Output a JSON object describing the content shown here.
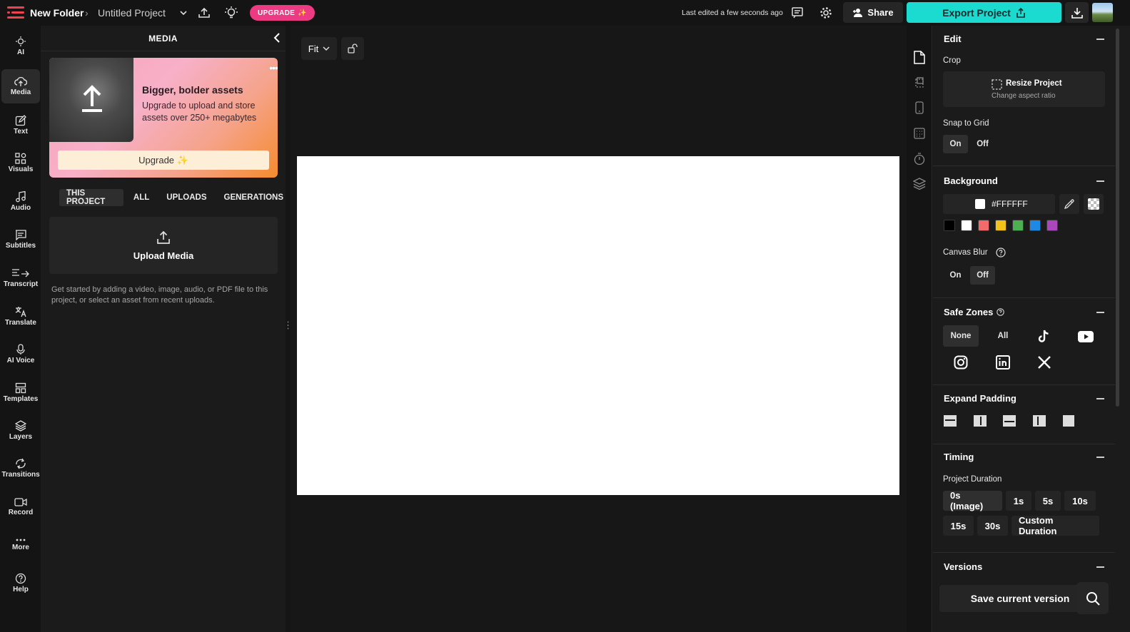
{
  "topbar": {
    "folder": "New Folder",
    "project": "Untitled Project",
    "upgrade_label": "UPGRADE",
    "last_edited": "Last edited a few seconds ago",
    "share_label": "Share",
    "export_label": "Export Project"
  },
  "leftnav": {
    "items": [
      {
        "label": "AI",
        "icon": "sparkle-icon"
      },
      {
        "label": "Media",
        "icon": "upload-cloud-icon"
      },
      {
        "label": "Text",
        "icon": "edit-icon"
      },
      {
        "label": "Visuals",
        "icon": "shapes-icon"
      },
      {
        "label": "Audio",
        "icon": "music-icon"
      },
      {
        "label": "Subtitles",
        "icon": "subtitles-icon"
      },
      {
        "label": "Transcript",
        "icon": "transcript-icon"
      },
      {
        "label": "Translate",
        "icon": "translate-icon"
      },
      {
        "label": "AI Voice",
        "icon": "voice-icon"
      },
      {
        "label": "Templates",
        "icon": "templates-icon"
      },
      {
        "label": "Layers",
        "icon": "layers-icon"
      },
      {
        "label": "Transitions",
        "icon": "transitions-icon"
      },
      {
        "label": "Record",
        "icon": "record-icon"
      },
      {
        "label": "More",
        "icon": "more-icon"
      },
      {
        "label": "Help",
        "icon": "help-icon"
      }
    ]
  },
  "media": {
    "title": "MEDIA",
    "promo": {
      "title": "Bigger, bolder assets",
      "text": "Upgrade to upload and store assets over 250+ megabytes",
      "button": "Upgrade ✨"
    },
    "tabs": [
      "THIS PROJECT",
      "ALL",
      "UPLOADS",
      "GENERATIONS"
    ],
    "upload_label": "Upload Media",
    "help_text": "Get started by adding a video, image, audio, or PDF file to this project, or select an asset from recent uploads."
  },
  "stage": {
    "fit_label": "Fit"
  },
  "props": {
    "edit_title": "Edit",
    "crop_label": "Crop",
    "resize_title": "Resize Project",
    "resize_sub": "Change aspect ratio",
    "snap_label": "Snap to Grid",
    "snap_on": "On",
    "snap_off": "Off",
    "background_title": "Background",
    "hex_value": "#FFFFFF",
    "swatches": [
      "#000000",
      "#ffffff",
      "#f26a6a",
      "#f2c21b",
      "#4caf50",
      "#1e88e5",
      "#ab47bc"
    ],
    "canvas_blur_label": "Canvas Blur",
    "blur_on": "On",
    "blur_off": "Off",
    "safe_zones_title": "Safe Zones",
    "sz_none": "None",
    "sz_all": "All",
    "expand_padding_title": "Expand Padding",
    "timing_title": "Timing",
    "duration_label": "Project Duration",
    "durations": [
      "0s (Image)",
      "1s",
      "5s",
      "10s",
      "15s",
      "30s",
      "Custom Duration"
    ],
    "versions_title": "Versions",
    "save_version": "Save current version"
  }
}
